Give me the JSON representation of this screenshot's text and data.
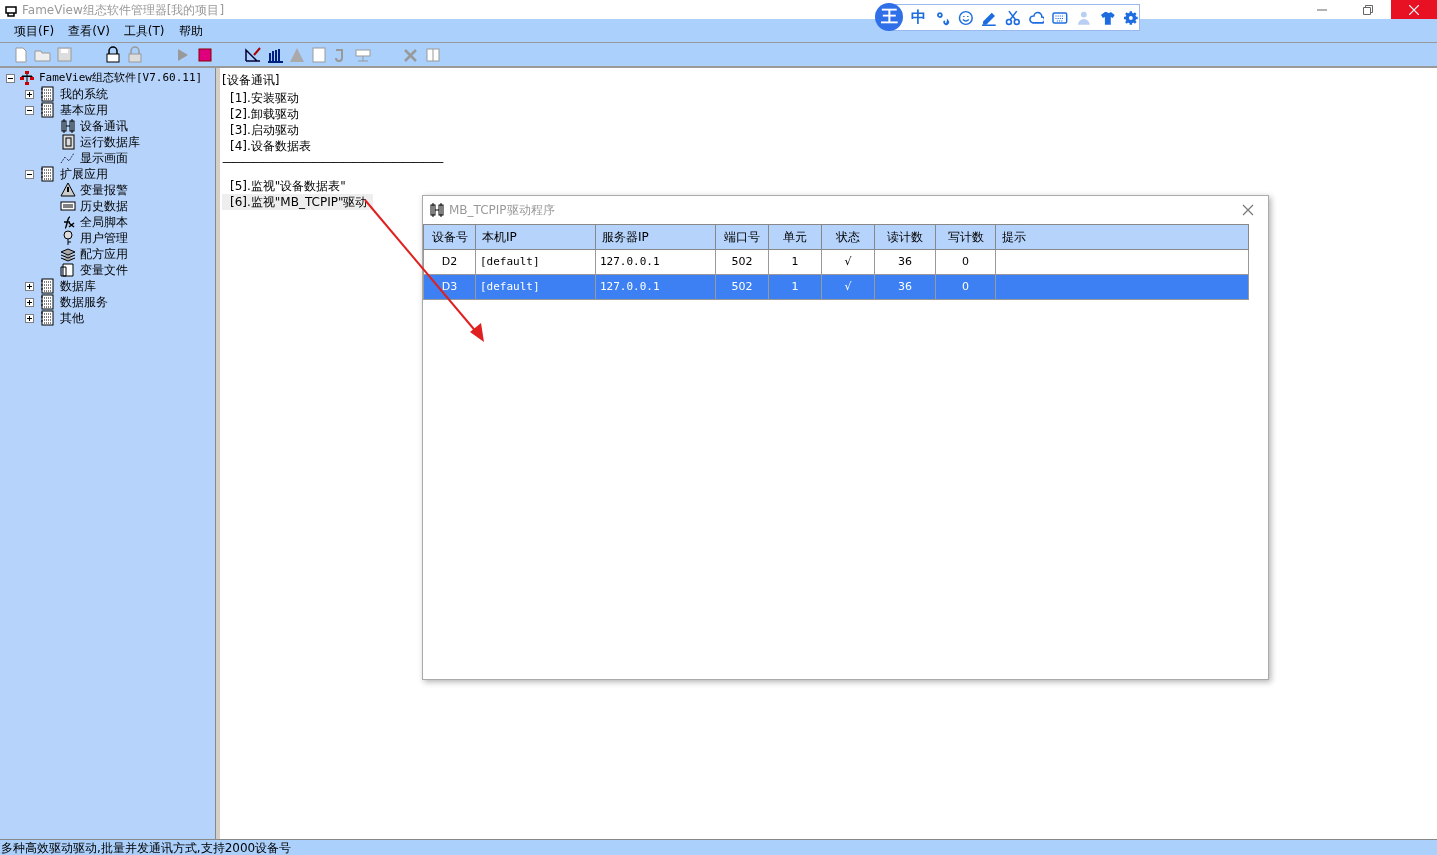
{
  "window": {
    "title": "FameView组态软件管理器[我的项目]"
  },
  "ime_toolbar": {
    "logo": "王",
    "mode": "中"
  },
  "menu": [
    "项目(F)",
    "查看(V)",
    "工具(T)",
    "帮助"
  ],
  "tree": {
    "label": "FameView组态软件[V7.60.11]",
    "expanded": true,
    "children": [
      {
        "label": "我的系统",
        "expanded": false
      },
      {
        "label": "基本应用",
        "expanded": true,
        "children": [
          {
            "label": "设备通讯"
          },
          {
            "label": "运行数据库"
          },
          {
            "label": "显示画面"
          }
        ]
      },
      {
        "label": "扩展应用",
        "expanded": true,
        "children": [
          {
            "label": "变量报警"
          },
          {
            "label": "历史数据"
          },
          {
            "label": "全局脚本"
          },
          {
            "label": "用户管理"
          },
          {
            "label": "配方应用"
          },
          {
            "label": "变量文件"
          }
        ]
      },
      {
        "label": "数据库",
        "expanded": false
      },
      {
        "label": "数据服务",
        "expanded": false
      },
      {
        "label": "其他",
        "expanded": false
      }
    ]
  },
  "content": {
    "heading": "[设备通讯]",
    "items": [
      "[1].安装驱动",
      "[2].卸载驱动",
      "[3].启动驱动",
      "[4].设备数据表"
    ],
    "separator": "——————————————————————",
    "items2": [
      {
        "label": "[5].监视\"设备数据表\"",
        "selected": false
      },
      {
        "label": "[6].监视\"MB_TCPIP\"驱动",
        "selected": true
      }
    ]
  },
  "dialog": {
    "title": "MB_TCPIP驱动程序",
    "columns": [
      "设备号",
      "本机IP",
      "服务器IP",
      "端口号",
      "单元",
      "状态",
      "读计数",
      "写计数",
      "提示"
    ],
    "rows": [
      {
        "selected": false,
        "cells": [
          "D2",
          "[default]",
          "127.0.0.1",
          "502",
          "1",
          "√",
          "36",
          "0",
          ""
        ]
      },
      {
        "selected": true,
        "cells": [
          "D3",
          "[default]",
          "127.0.0.1",
          "502",
          "1",
          "√",
          "36",
          "0",
          ""
        ]
      }
    ]
  },
  "status_bar": "多种高效驱动驱动,批量并发通讯方式,支持2000设备号"
}
